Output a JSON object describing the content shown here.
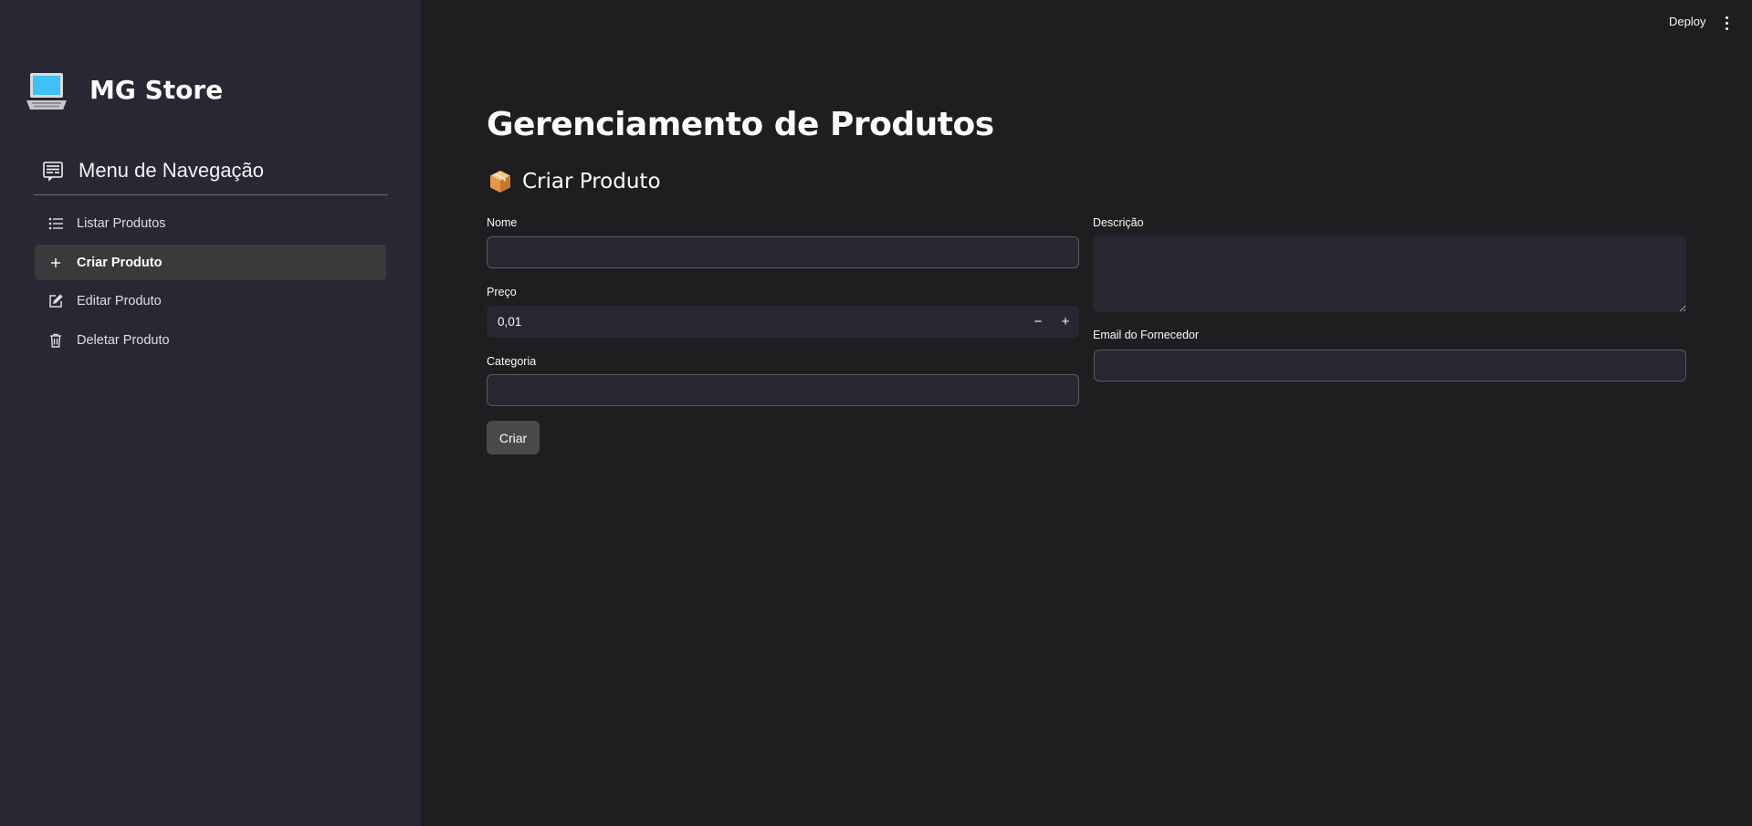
{
  "app": {
    "name": "MG Store",
    "brand_icon": "laptop-icon"
  },
  "sidebar": {
    "menu_title": "Menu de Navegação",
    "menu_icon": "newspaper-icon",
    "items": [
      {
        "label": "Listar Produtos",
        "icon": "list-icon",
        "active": false
      },
      {
        "label": "Criar Produto",
        "icon": "plus-icon",
        "active": true
      },
      {
        "label": "Editar Produto",
        "icon": "edit-icon",
        "active": false
      },
      {
        "label": "Deletar Produto",
        "icon": "trash-icon",
        "active": false
      }
    ]
  },
  "toolbar": {
    "deploy_label": "Deploy",
    "menu_icon": "vertical-dots-icon"
  },
  "main": {
    "title": "Gerenciamento de Produtos",
    "section_title": "Criar Produto",
    "section_icon": "package-icon",
    "form": {
      "nome": {
        "label": "Nome",
        "value": ""
      },
      "preco": {
        "label": "Preço",
        "value": "0,01",
        "decrement": "−",
        "increment": "+"
      },
      "categoria": {
        "label": "Categoria",
        "value": ""
      },
      "descricao": {
        "label": "Descrição",
        "value": ""
      },
      "email": {
        "label": "Email do Fornecedor",
        "value": ""
      },
      "submit_label": "Criar"
    }
  },
  "colors": {
    "background": "#1e1e21",
    "sidebar": "#272833",
    "input": "#262731",
    "active_item": "#3a3a3d",
    "button": "#4a4a4d"
  }
}
